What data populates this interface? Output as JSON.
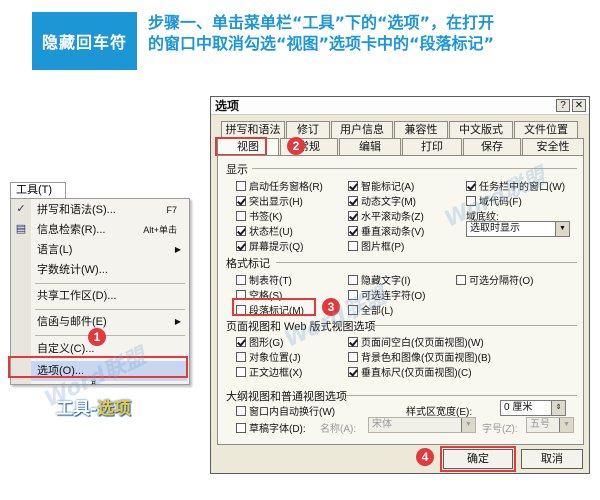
{
  "header": {
    "badge": "隐藏回车符",
    "line1": "步骤一、单击菜单栏“工具”下的“选项”，在打开",
    "line2": "的窗口中取消勾选“视图”选项卡中的“段落标记”"
  },
  "menu": {
    "title": "工具(T)",
    "items": [
      {
        "label": "拼写和语法(S)...",
        "shortcut": "F7"
      },
      {
        "label": "信息检索(R)...",
        "shortcut": "Alt+单击"
      },
      {
        "label": "语言(L)",
        "submenu": "▶"
      },
      {
        "label": "字数统计(W)..."
      },
      {
        "label": "共享工作区(D)..."
      },
      {
        "label": "信函与邮件(E)",
        "submenu": "▶"
      },
      {
        "label": "自定义(C)..."
      },
      {
        "label": "选项(O)..."
      }
    ],
    "expand": "¤",
    "caption_main": "工具-",
    "caption_accent": "选项"
  },
  "steps": [
    "1",
    "2",
    "3",
    "4"
  ],
  "dialog": {
    "title": "选项",
    "help_btn": "?",
    "close_btn": "✕",
    "tabs_row1": [
      "拼写和语法",
      "修订",
      "用户信息",
      "兼容性",
      "中文版式",
      "文件位置"
    ],
    "tabs_row2": [
      "视图",
      "常规",
      "编辑",
      "打印",
      "保存",
      "安全性"
    ],
    "show": {
      "label": "显示",
      "col1": [
        {
          "label": "启动任务窗格(R)",
          "checked": false
        },
        {
          "label": "突出显示(H)",
          "checked": true
        },
        {
          "label": "书签(K)",
          "checked": false
        },
        {
          "label": "状态栏(U)",
          "checked": true
        },
        {
          "label": "屏幕提示(Q)",
          "checked": true
        }
      ],
      "col2": [
        {
          "label": "智能标记(A)",
          "checked": true
        },
        {
          "label": "动态文字(M)",
          "checked": true
        },
        {
          "label": "水平滚动条(Z)",
          "checked": true
        },
        {
          "label": "垂直滚动条(V)",
          "checked": true
        },
        {
          "label": "图片框(P)",
          "checked": false
        }
      ],
      "col3": [
        {
          "label": "任务栏中的窗口(W)",
          "checked": true
        },
        {
          "label": "域代码(F)",
          "checked": false
        }
      ],
      "shading_label": "域底纹:",
      "shading_value": "选取时显示"
    },
    "format": {
      "label": "格式标记",
      "col1": [
        {
          "label": "制表符(T)",
          "checked": false
        },
        {
          "label": "空格(S)",
          "checked": false
        },
        {
          "label": "段落标记(M)",
          "checked": false
        }
      ],
      "col2": [
        {
          "label": "隐藏文字(I)",
          "checked": false
        },
        {
          "label": "可选连字符(O)",
          "checked": false
        },
        {
          "label": "全部(L)",
          "checked": false
        }
      ],
      "col3": [
        {
          "label": "可选分隔符(O)",
          "checked": false
        }
      ]
    },
    "page_view": {
      "label": "页面视图和 Web 版式视图选项",
      "col1": [
        {
          "label": "图形(G)",
          "checked": true
        },
        {
          "label": "对象位置(J)",
          "checked": false
        },
        {
          "label": "正文边框(X)",
          "checked": false
        }
      ],
      "col2": [
        {
          "label": "页面间空白(仅页面视图)(W)",
          "checked": true
        },
        {
          "label": "背景色和图像(仅页面视图)(B)",
          "checked": false
        },
        {
          "label": "垂直标尺(仅页面视图)(C)",
          "checked": true
        }
      ]
    },
    "outline": {
      "label": "大纲视图和普通视图选项",
      "wrap": {
        "label": "窗口内自动换行(W)",
        "checked": false
      },
      "draft": {
        "label": "草稿字体(D):",
        "checked": false
      },
      "width_label": "样式区宽度(E):",
      "width_value": "0 厘米",
      "font_name_label": "名称(A):",
      "font_name_value": "宋体",
      "font_size_label": "字号(Z):",
      "font_size_value": "五号"
    },
    "ok": "确定",
    "cancel": "取消"
  },
  "watermarks": [
    "Word联盟",
    "Word联盟",
    "Word联盟"
  ]
}
